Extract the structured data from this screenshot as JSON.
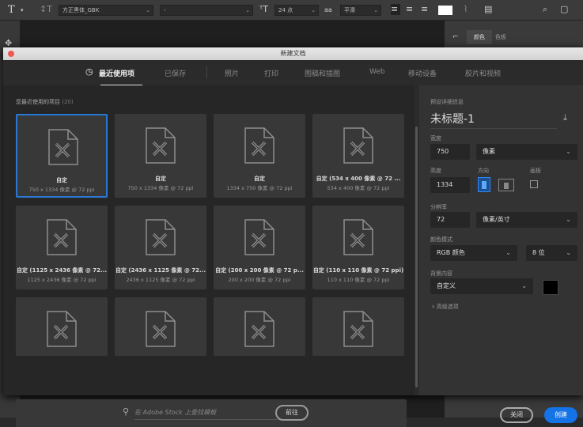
{
  "toolbar": {
    "font_family": "方正黑体_GBK",
    "font_style": "-",
    "font_size": "24 点",
    "antialias": "平滑"
  },
  "right_panel": {
    "tabs": [
      "颜色",
      "色板"
    ]
  },
  "dialog": {
    "title": "新建文档",
    "tabs": [
      {
        "label": "最近使用项",
        "active": true
      },
      {
        "label": "已保存"
      },
      {
        "label": "照片"
      },
      {
        "label": "打印"
      },
      {
        "label": "图稿和插图"
      },
      {
        "label": "Web"
      },
      {
        "label": "移动设备"
      },
      {
        "label": "胶片和视频"
      }
    ],
    "recent": {
      "heading": "您最近使用的项目",
      "count": "(20)",
      "items": [
        {
          "name": "自定",
          "size": "750 x 1334 像素 @ 72 ppi",
          "selected": true
        },
        {
          "name": "自定",
          "size": "750 x 1334 像素 @ 72 ppi"
        },
        {
          "name": "自定",
          "size": "1334 x 750 像素 @ 72 ppi"
        },
        {
          "name": "自定 (534 x 400 像素 @ 72 ...",
          "size": "534 x 400 像素 @ 72 ppi"
        },
        {
          "name": "自定 (1125 x 2436 像素 @ 72...",
          "size": "1125 x 2436 像素 @ 72 ppi"
        },
        {
          "name": "自定 (2436 x 1125 像素 @ 72...",
          "size": "2436 x 1125 像素 @ 72 ppi"
        },
        {
          "name": "自定 (200 x 200 像素 @ 72 p...",
          "size": "200 x 200 像素 @ 72 ppi"
        },
        {
          "name": "自定 (110 x 110 像素 @ 72 ppi)",
          "size": "110 x 110 像素 @ 72 ppi"
        },
        {
          "name": "",
          "size": ""
        },
        {
          "name": "",
          "size": ""
        },
        {
          "name": "",
          "size": ""
        },
        {
          "name": "",
          "size": ""
        }
      ]
    },
    "search": {
      "placeholder": "在 Adobe Stock 上查找模板",
      "go_label": "前往"
    },
    "details": {
      "heading": "预设详细信息",
      "doc_name": "未标题-1",
      "width_label": "宽度",
      "width": "750",
      "width_unit": "像素",
      "height_label": "高度",
      "height": "1334",
      "orientation_label": "方向",
      "orientation": "portrait",
      "artboard_label": "画板",
      "artboard": false,
      "resolution_label": "分辨率",
      "resolution": "72",
      "resolution_unit": "像素/英寸",
      "color_mode_label": "颜色模式",
      "color_mode": "RGB 颜色",
      "bit_depth": "8 位",
      "background_label": "背景内容",
      "background": "自定义",
      "background_color": "#000000",
      "advanced_label": "高级选项",
      "close_label": "关闭",
      "create_label": "创建"
    },
    "accent": "#1473e6"
  }
}
